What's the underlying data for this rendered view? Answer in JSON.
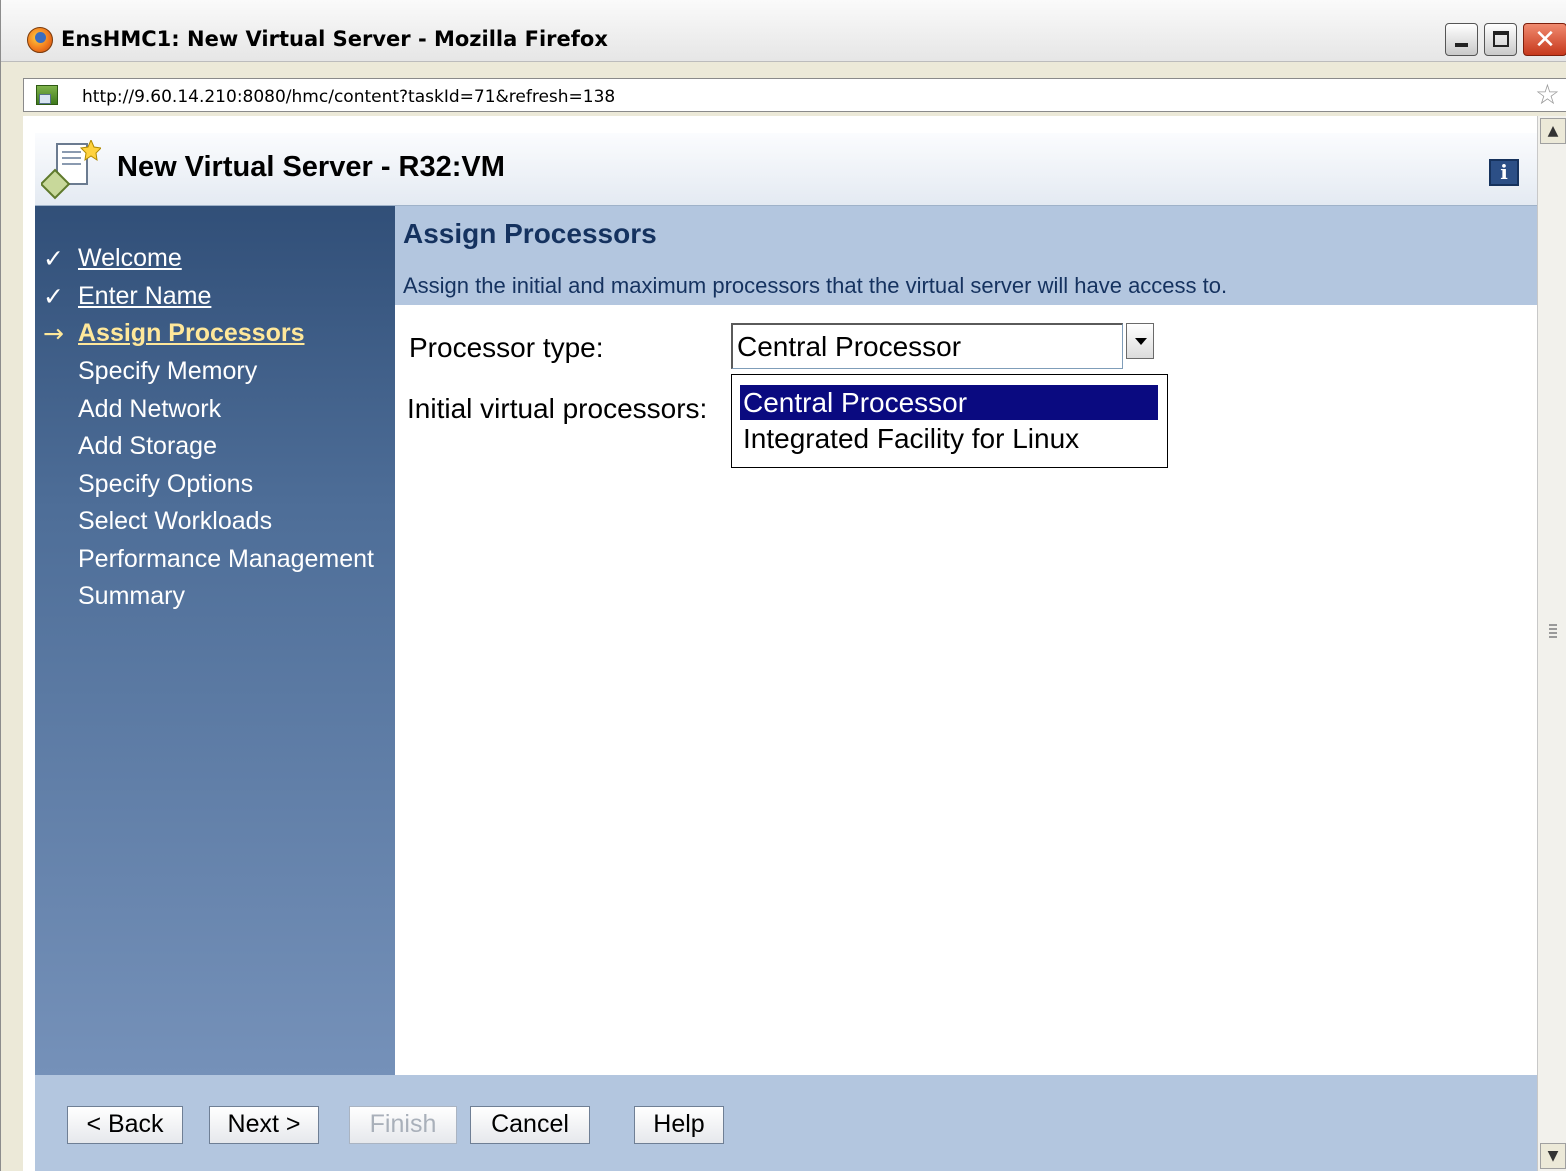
{
  "window": {
    "title": "EnsHMC1: New Virtual Server - Mozilla Firefox",
    "url": "http://9.60.14.210:8080/hmc/content?taskId=71&refresh=138"
  },
  "task": {
    "title": "New Virtual Server - R32:VM",
    "info_icon": "i"
  },
  "nav": {
    "items": [
      {
        "label": "Welcome",
        "mark": "✓",
        "state": "completed"
      },
      {
        "label": "Enter Name",
        "mark": "✓",
        "state": "completed"
      },
      {
        "label": "Assign Processors",
        "mark": "→",
        "state": "current"
      },
      {
        "label": "Specify Memory",
        "mark": "",
        "state": "pending"
      },
      {
        "label": "Add Network",
        "mark": "",
        "state": "pending"
      },
      {
        "label": "Add Storage",
        "mark": "",
        "state": "pending"
      },
      {
        "label": "Specify Options",
        "mark": "",
        "state": "pending"
      },
      {
        "label": "Select Workloads",
        "mark": "",
        "state": "pending"
      },
      {
        "label": "Performance Management",
        "mark": "",
        "state": "pending"
      },
      {
        "label": "Summary",
        "mark": "",
        "state": "pending"
      }
    ]
  },
  "page": {
    "title": "Assign Processors",
    "description": "Assign the initial and maximum processors that the virtual server will have access to."
  },
  "form": {
    "processor_type_label": "Processor type:",
    "processor_type_value": "Central Processor",
    "processor_type_options": [
      "Central Processor",
      "Integrated Facility for Linux"
    ],
    "initial_processors_label": "Initial virtual processors:"
  },
  "buttons": {
    "back": "< Back",
    "next": "Next >",
    "finish": "Finish",
    "cancel": "Cancel",
    "help": "Help"
  },
  "colors": {
    "sidebar": "#4e6e98",
    "header_band": "#b3c6df",
    "current_step": "#ffe89a",
    "selected_option": "#0a0a80"
  }
}
